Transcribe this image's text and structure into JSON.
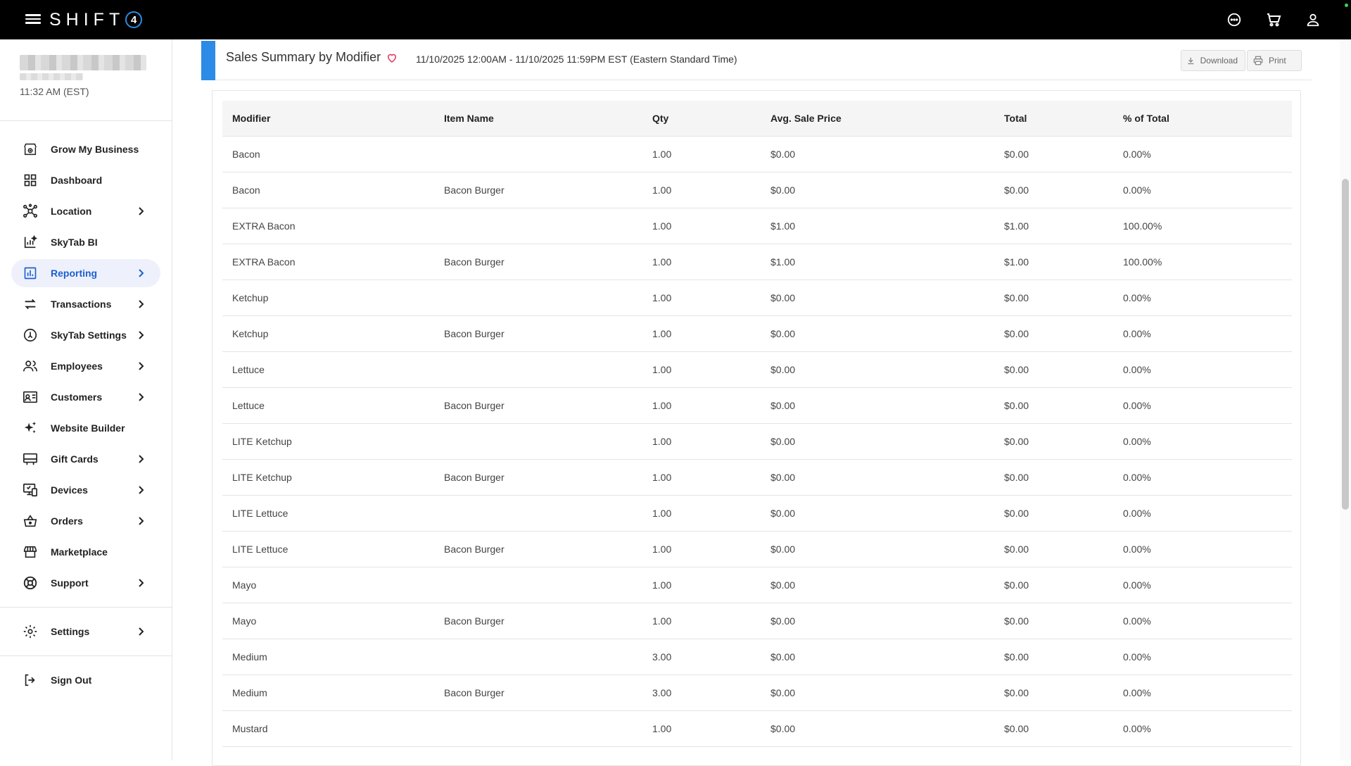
{
  "topbar": {
    "brand_text": "SHIFT",
    "brand_number": "4"
  },
  "sidebar": {
    "clock": "11:32 AM (EST)",
    "items": [
      {
        "label": "Grow My Business",
        "icon": "store-growth-icon",
        "has_chevron": false
      },
      {
        "label": "Dashboard",
        "icon": "dashboard-grid-icon",
        "has_chevron": false
      },
      {
        "label": "Location",
        "icon": "location-network-icon",
        "has_chevron": true
      },
      {
        "label": "SkyTab BI",
        "icon": "analytics-chart-icon",
        "has_chevron": false
      },
      {
        "label": "Reporting",
        "icon": "bar-chart-icon",
        "has_chevron": true,
        "active": true
      },
      {
        "label": "Transactions",
        "icon": "transfer-arrows-icon",
        "has_chevron": true
      },
      {
        "label": "SkyTab Settings",
        "icon": "skytab-settings-icon",
        "has_chevron": true
      },
      {
        "label": "Employees",
        "icon": "employees-icon",
        "has_chevron": true
      },
      {
        "label": "Customers",
        "icon": "customers-card-icon",
        "has_chevron": true
      },
      {
        "label": "Website Builder",
        "icon": "sparkle-icon",
        "has_chevron": false
      },
      {
        "label": "Gift Cards",
        "icon": "gift-card-icon",
        "has_chevron": true
      },
      {
        "label": "Devices",
        "icon": "devices-icon",
        "has_chevron": true
      },
      {
        "label": "Orders",
        "icon": "basket-icon",
        "has_chevron": true
      },
      {
        "label": "Marketplace",
        "icon": "marketplace-icon",
        "has_chevron": false
      },
      {
        "label": "Support",
        "icon": "lifebuoy-icon",
        "has_chevron": true
      }
    ],
    "settings_label": "Settings",
    "signout_label": "Sign Out"
  },
  "report": {
    "title": "Sales Summary by Modifier",
    "date_range": "11/10/2025 12:00AM - 11/10/2025 11:59PM EST (Eastern Standard Time)",
    "download_label": "Download",
    "print_label": "Print"
  },
  "table": {
    "columns": [
      "Modifier",
      "Item Name",
      "Qty",
      "Avg. Sale Price",
      "Total",
      "% of Total"
    ],
    "rows": [
      [
        "Bacon",
        "",
        "1.00",
        "$0.00",
        "$0.00",
        "0.00%"
      ],
      [
        "Bacon",
        "Bacon Burger",
        "1.00",
        "$0.00",
        "$0.00",
        "0.00%"
      ],
      [
        "EXTRA Bacon",
        "",
        "1.00",
        "$1.00",
        "$1.00",
        "100.00%"
      ],
      [
        "EXTRA Bacon",
        "Bacon Burger",
        "1.00",
        "$1.00",
        "$1.00",
        "100.00%"
      ],
      [
        "Ketchup",
        "",
        "1.00",
        "$0.00",
        "$0.00",
        "0.00%"
      ],
      [
        "Ketchup",
        "Bacon Burger",
        "1.00",
        "$0.00",
        "$0.00",
        "0.00%"
      ],
      [
        "Lettuce",
        "",
        "1.00",
        "$0.00",
        "$0.00",
        "0.00%"
      ],
      [
        "Lettuce",
        "Bacon Burger",
        "1.00",
        "$0.00",
        "$0.00",
        "0.00%"
      ],
      [
        "LITE Ketchup",
        "",
        "1.00",
        "$0.00",
        "$0.00",
        "0.00%"
      ],
      [
        "LITE Ketchup",
        "Bacon Burger",
        "1.00",
        "$0.00",
        "$0.00",
        "0.00%"
      ],
      [
        "LITE Lettuce",
        "",
        "1.00",
        "$0.00",
        "$0.00",
        "0.00%"
      ],
      [
        "LITE Lettuce",
        "Bacon Burger",
        "1.00",
        "$0.00",
        "$0.00",
        "0.00%"
      ],
      [
        "Mayo",
        "",
        "1.00",
        "$0.00",
        "$0.00",
        "0.00%"
      ],
      [
        "Mayo",
        "Bacon Burger",
        "1.00",
        "$0.00",
        "$0.00",
        "0.00%"
      ],
      [
        "Medium",
        "",
        "3.00",
        "$0.00",
        "$0.00",
        "0.00%"
      ],
      [
        "Medium",
        "Bacon Burger",
        "3.00",
        "$0.00",
        "$0.00",
        "0.00%"
      ],
      [
        "Mustard",
        "",
        "1.00",
        "$0.00",
        "$0.00",
        "0.00%"
      ]
    ]
  },
  "colors": {
    "accent": "#2b8be6",
    "active_nav": "#1d5fd1",
    "favorite": "#e0486b"
  }
}
